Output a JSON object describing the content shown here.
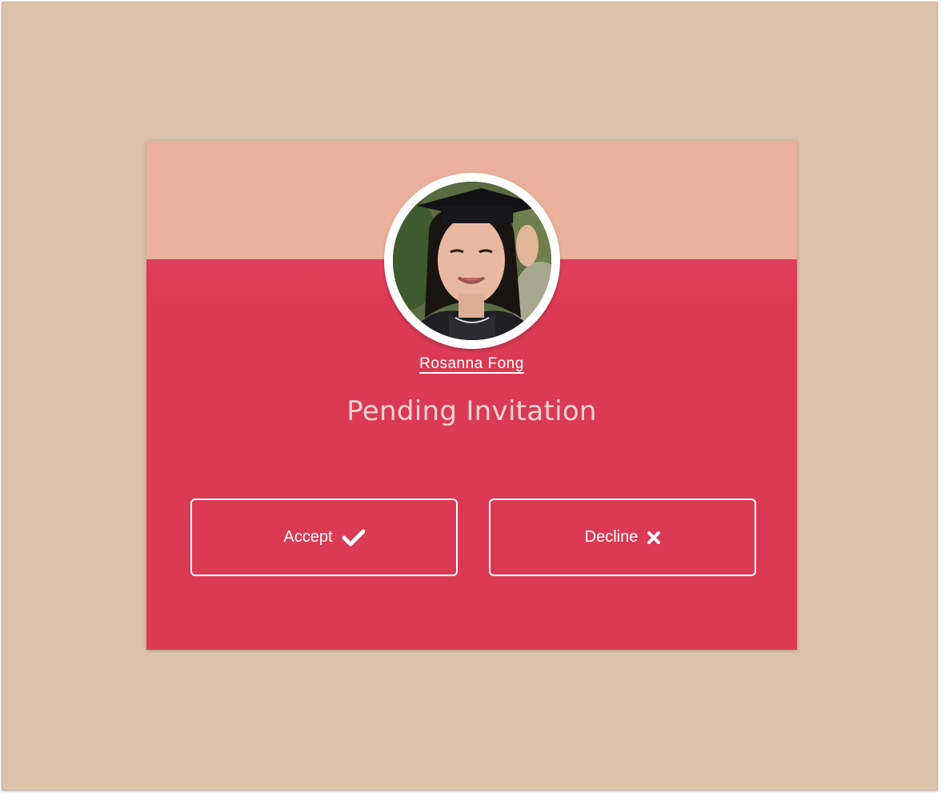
{
  "card": {
    "user_name": "Rosanna Fong",
    "title": "Pending Invitation"
  },
  "actions": {
    "accept_label": "Accept",
    "accept_icon": "check-icon",
    "decline_label": "Decline",
    "decline_icon": "x-icon"
  },
  "colors": {
    "background": "#dbc2aa",
    "card_header": "#e9b19b",
    "card_body": "#da3a53",
    "title_text": "#f3d2d2",
    "button_border": "#ffffff"
  }
}
